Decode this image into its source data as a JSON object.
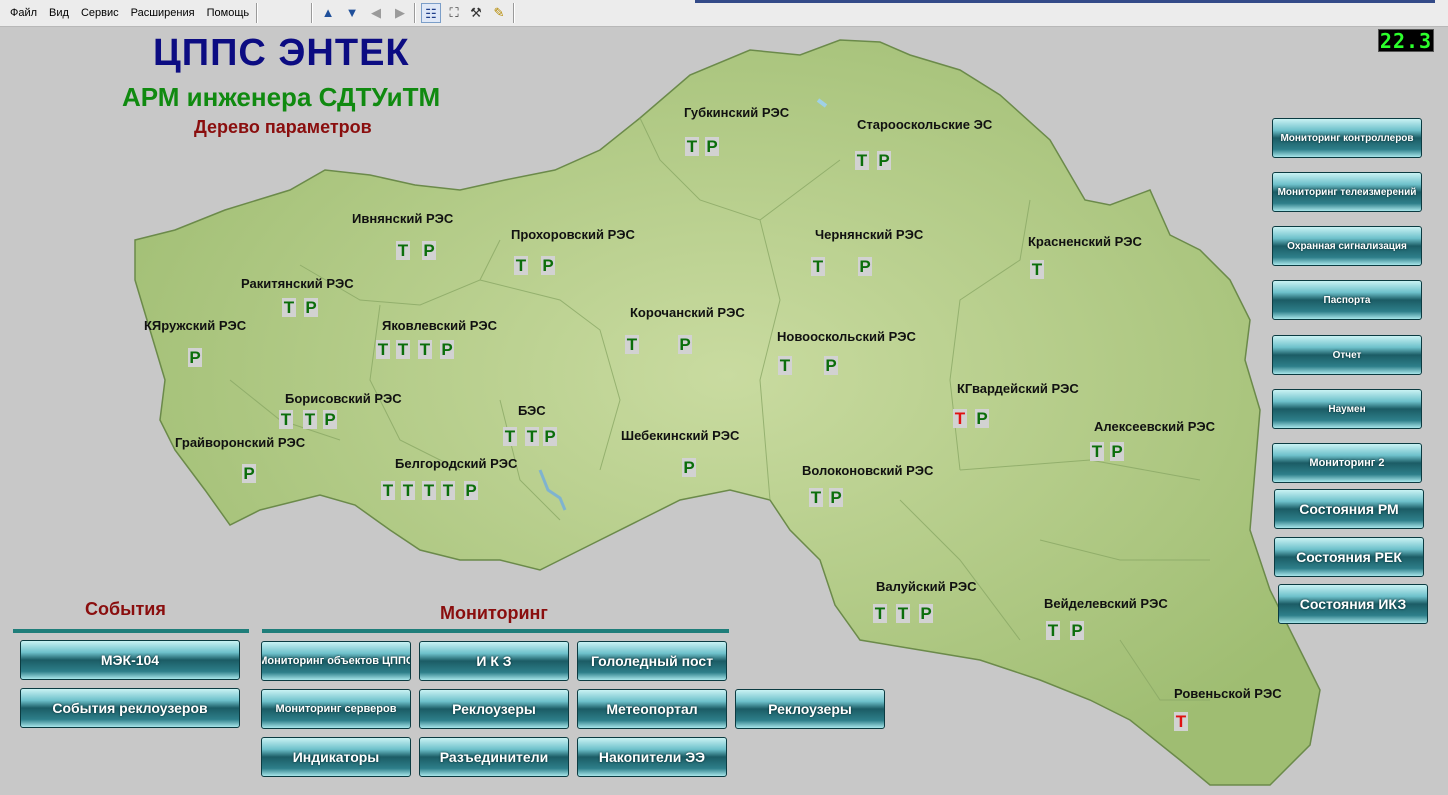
{
  "menu": [
    "Файл",
    "Вид",
    "Сервис",
    "Расширения",
    "Помощь"
  ],
  "toolbar": {
    "icons": [
      "arrow-up-icon",
      "arrow-down-icon",
      "back-icon",
      "forward-icon",
      "tree-icon",
      "fit-icon",
      "tools-icon",
      "note-icon"
    ]
  },
  "clock": "22.3",
  "header": {
    "title": "ЦППС ЭНТЕК",
    "subtitle": "АРМ инженера СДТУиТМ",
    "subtitle2": "Дерево параметров"
  },
  "regions": [
    {
      "name": "Губкинский РЭС",
      "markers": [
        "Т",
        "Р"
      ]
    },
    {
      "name": "Старооскольские ЭС",
      "markers": [
        "Т",
        "Р"
      ]
    },
    {
      "name": "Ивнянский РЭС",
      "markers": [
        "Т",
        "Р"
      ]
    },
    {
      "name": "Прохоровский РЭС",
      "markers": [
        "Т",
        "Р"
      ]
    },
    {
      "name": "Чернянский РЭС",
      "markers": [
        "Т",
        "Р"
      ]
    },
    {
      "name": "Красненский РЭС",
      "markers": [
        "Т"
      ]
    },
    {
      "name": "Ракитянский РЭС",
      "markers": [
        "Т",
        "Р"
      ]
    },
    {
      "name": "КЯружский РЭС",
      "markers": [
        "Р"
      ]
    },
    {
      "name": "Яковлевский РЭС",
      "markers": [
        "Т",
        "Т",
        "Т",
        "Р"
      ]
    },
    {
      "name": "Корочанский РЭС",
      "markers": [
        "Т",
        "Р"
      ]
    },
    {
      "name": "Новооскольский РЭС",
      "markers": [
        "Т",
        "Р"
      ]
    },
    {
      "name": "КГвардейский РЭС",
      "markers": [
        "Т",
        "Р"
      ],
      "red": [
        0
      ]
    },
    {
      "name": "Борисовский РЭС",
      "markers": [
        "Т",
        "Т",
        "Р"
      ]
    },
    {
      "name": "БЭС",
      "markers": [
        "Т",
        "Т",
        "Р"
      ]
    },
    {
      "name": "Алексеевский РЭС",
      "markers": [
        "Т",
        "Р"
      ]
    },
    {
      "name": "Грайворонский РЭС",
      "markers": [
        "Р"
      ]
    },
    {
      "name": "Шебекинский РЭС",
      "markers": [
        "Р"
      ]
    },
    {
      "name": "Белгородский РЭС",
      "markers": [
        "Т",
        "Т",
        "Т",
        "Т",
        "Р"
      ]
    },
    {
      "name": "Волоконовский РЭС",
      "markers": [
        "Т",
        "Р"
      ]
    },
    {
      "name": "Валуйский РЭС",
      "markers": [
        "Т",
        "Т",
        "Р"
      ]
    },
    {
      "name": "Вейделевский РЭС",
      "markers": [
        "Т",
        "Р"
      ]
    },
    {
      "name": "Ровеньской РЭС",
      "markers": [
        "Т"
      ],
      "red": [
        0
      ]
    }
  ],
  "right_buttons": [
    "Мониторинг контроллеров",
    "Мониторинг телеизмерений",
    "Охранная сигнализация",
    "Паспорта",
    "Отчет",
    "Наумен",
    "Мониторинг 2",
    "Состояния РМ",
    "Состояния РЕК",
    "Состояния ИКЗ"
  ],
  "events": {
    "title": "События",
    "buttons": [
      "МЭК-104",
      "События реклоузеров"
    ]
  },
  "monitoring": {
    "title": "Мониторинг",
    "buttons": [
      "Мониторинг объектов ЦППС",
      "И К З",
      "Гололедный пост",
      "Мониторинг серверов",
      "Реклоузеры",
      "Метеопортал",
      "Реклоузеры",
      "Индикаторы",
      "Разъединители",
      "Накопители ЭЭ"
    ]
  },
  "colors": {
    "marker_green": "#0b6e0b",
    "marker_red": "#e01010",
    "title_blue": "#0c0c82",
    "title_green": "#108a10",
    "title_red": "#8a0e0e"
  }
}
